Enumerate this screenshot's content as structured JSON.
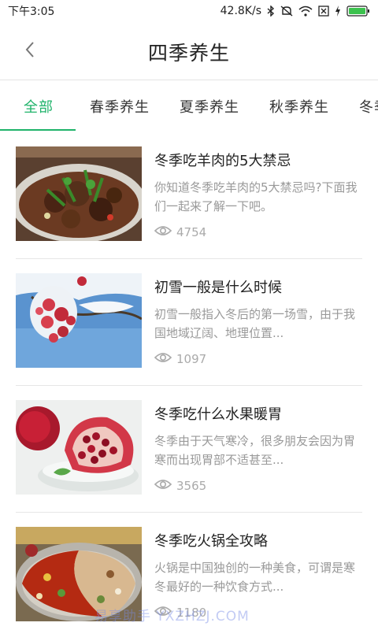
{
  "status_bar": {
    "time": "下午3:05",
    "network_speed": "42.8K/s",
    "icons": [
      "bluetooth-icon",
      "mute-icon",
      "wifi-icon",
      "sim-icon",
      "charging-icon",
      "battery-icon"
    ],
    "battery_color": "#3cc24e"
  },
  "header": {
    "title": "四季养生",
    "back_icon": "chevron-left-icon"
  },
  "tabs": {
    "items": [
      {
        "label": "全部",
        "active": true
      },
      {
        "label": "春季养生",
        "active": false
      },
      {
        "label": "夏季养生",
        "active": false
      },
      {
        "label": "秋季养生",
        "active": false
      },
      {
        "label": "冬季养生",
        "active": false
      }
    ],
    "accent_color": "#1fb36a"
  },
  "articles": [
    {
      "title": "冬季吃羊肉的5大禁忌",
      "description": "你知道冬季吃羊肉的5大禁忌吗?下面我们一起来了解一下吧。",
      "views": "4754",
      "thumbnail": "mutton-dish-image"
    },
    {
      "title": "初雪一般是什么时候",
      "description": "初雪一般指入冬后的第一场雪，由于我国地域辽阔、地理位置...",
      "views": "1097",
      "thumbnail": "snow-berries-image"
    },
    {
      "title": "冬季吃什么水果暖胃",
      "description": "冬季由于天气寒冷，很多朋友会因为胃寒而出现胃部不适甚至...",
      "views": "3565",
      "thumbnail": "pomegranate-image"
    },
    {
      "title": "冬季吃火锅全攻略",
      "description": "火锅是中国独创的一种美食，可谓是寒冬最好的一种饮食方式...",
      "views": "1180",
      "thumbnail": "hotpot-image"
    }
  ],
  "watermark": "易享助手 YXZHZJ.COM"
}
